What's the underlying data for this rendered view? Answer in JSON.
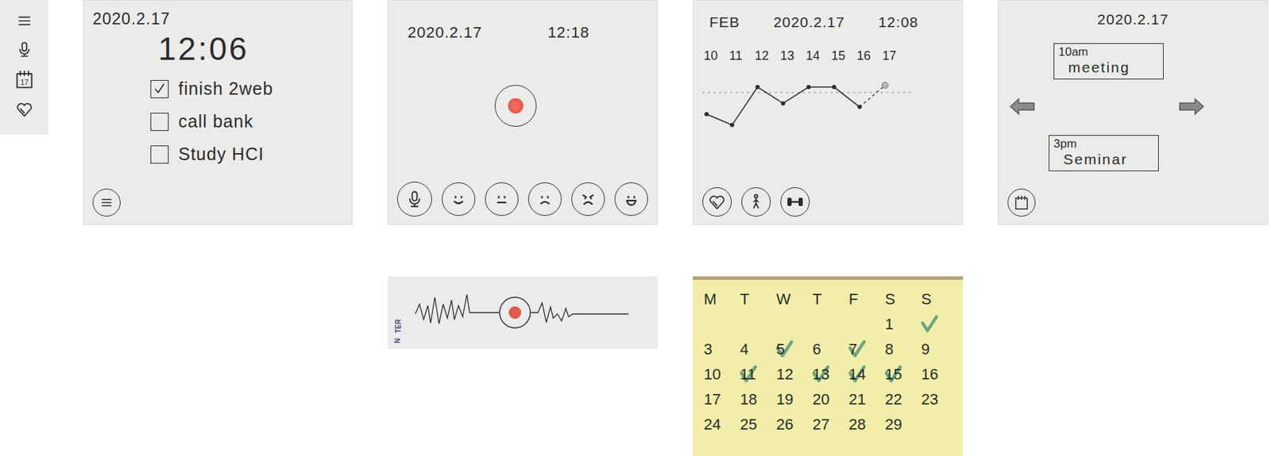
{
  "sidebar": {
    "calendar_badge": "17"
  },
  "todo_card": {
    "date": "2020.2.17",
    "time": "12:06",
    "items": [
      {
        "label": "finish 2web",
        "checked": true
      },
      {
        "label": "call bank",
        "checked": false
      },
      {
        "label": "Study HCI",
        "checked": false
      }
    ]
  },
  "recorder_card": {
    "date": "2020.2.17",
    "time": "12:18"
  },
  "waveform_strip": {
    "printed_marks": [
      "TER",
      "N"
    ]
  },
  "mood_chart_card": {
    "month": "FEB",
    "date": "2020.2.17",
    "time": "12:08",
    "days": [
      "10",
      "11",
      "12",
      "13",
      "14",
      "15",
      "16",
      "17"
    ],
    "values": [
      2.5,
      1.9,
      4,
      3.1,
      4,
      4,
      2.9
    ],
    "forecast": 4.1,
    "average": 3.7
  },
  "day_card": {
    "date": "2020.2.17",
    "events": [
      {
        "time": "10am",
        "title": "meeting"
      },
      {
        "time": "3pm",
        "title": "Seminar"
      }
    ]
  },
  "month_calendar": {
    "weekdays": [
      "M",
      "T",
      "W",
      "T",
      "F",
      "S",
      "S"
    ],
    "weeks": [
      [
        {
          "day": "",
          "checked": false
        },
        {
          "day": "",
          "checked": false
        },
        {
          "day": "",
          "checked": false
        },
        {
          "day": "",
          "checked": false
        },
        {
          "day": "",
          "checked": false
        },
        {
          "day": "1",
          "checked": false
        },
        {
          "day": "",
          "checked": true
        }
      ],
      [
        {
          "day": "3",
          "checked": false
        },
        {
          "day": "4",
          "checked": false
        },
        {
          "day": "5",
          "checked": true
        },
        {
          "day": "6",
          "checked": false
        },
        {
          "day": "7",
          "checked": true
        },
        {
          "day": "8",
          "checked": false
        },
        {
          "day": "9",
          "checked": false
        }
      ],
      [
        {
          "day": "10",
          "checked": false
        },
        {
          "day": "11",
          "checked": true
        },
        {
          "day": "12",
          "checked": false
        },
        {
          "day": "13",
          "checked": true
        },
        {
          "day": "14",
          "checked": true
        },
        {
          "day": "15",
          "checked": true
        },
        {
          "day": "16",
          "checked": false
        }
      ],
      [
        {
          "day": "17",
          "checked": false
        },
        {
          "day": "18",
          "checked": false
        },
        {
          "day": "19",
          "checked": false
        },
        {
          "day": "20",
          "checked": false
        },
        {
          "day": "21",
          "checked": false
        },
        {
          "day": "22",
          "checked": false
        },
        {
          "day": "23",
          "checked": false
        }
      ],
      [
        {
          "day": "24",
          "checked": false
        },
        {
          "day": "25",
          "checked": false
        },
        {
          "day": "26",
          "checked": false
        },
        {
          "day": "27",
          "checked": false
        },
        {
          "day": "28",
          "checked": false
        },
        {
          "day": "29",
          "checked": false
        },
        {
          "day": "",
          "checked": false
        }
      ]
    ]
  }
}
